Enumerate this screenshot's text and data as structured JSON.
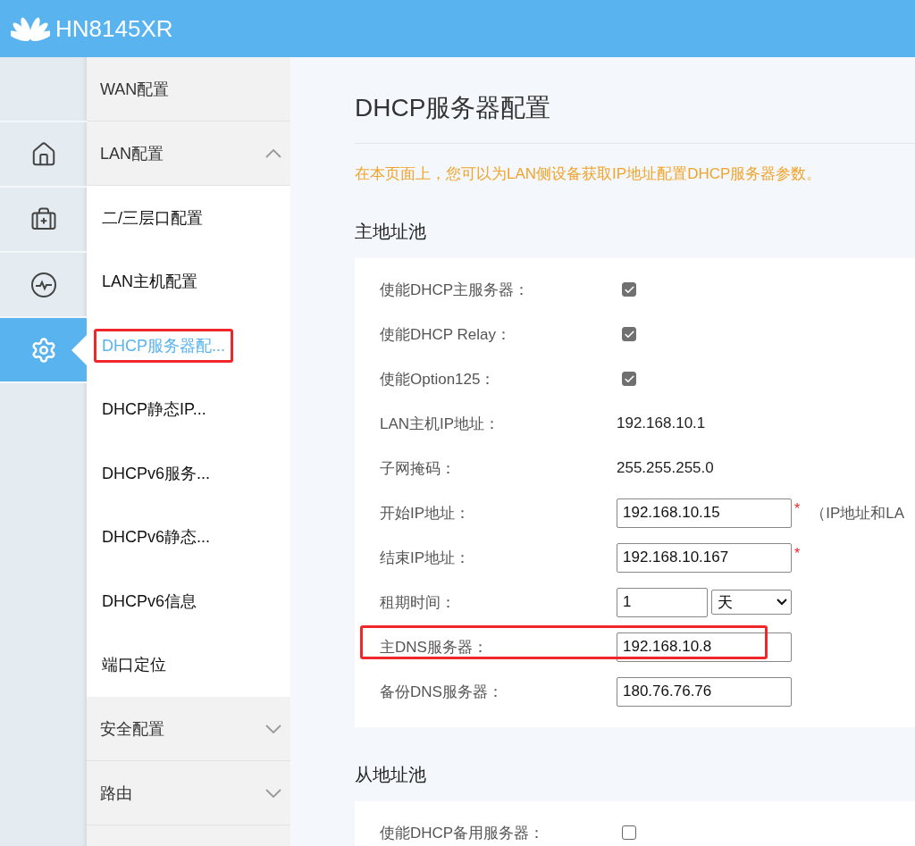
{
  "header": {
    "title": "HN8145XR"
  },
  "rail": [
    {
      "kind": "blank",
      "selected": false
    },
    {
      "kind": "home",
      "selected": false
    },
    {
      "kind": "kit",
      "selected": false
    },
    {
      "kind": "monitor",
      "selected": false
    },
    {
      "kind": "settings",
      "selected": true
    }
  ],
  "menu": [
    {
      "kind": "link",
      "label": "WAN配置"
    },
    {
      "kind": "group",
      "label": "LAN配置",
      "expanded": true,
      "children": [
        {
          "label": "二/三层口配置",
          "selected": false,
          "highlighted": false
        },
        {
          "label": "LAN主机配置",
          "selected": false,
          "highlighted": false
        },
        {
          "label": "DHCP服务器配...",
          "selected": true,
          "highlighted": true
        },
        {
          "label": "DHCP静态IP...",
          "selected": false,
          "highlighted": false
        },
        {
          "label": "DHCPv6服务...",
          "selected": false,
          "highlighted": false
        },
        {
          "label": "DHCPv6静态...",
          "selected": false,
          "highlighted": false
        },
        {
          "label": "DHCPv6信息",
          "selected": false,
          "highlighted": false
        },
        {
          "label": "端口定位",
          "selected": false,
          "highlighted": false
        }
      ]
    },
    {
      "kind": "group",
      "label": "安全配置",
      "expanded": false
    },
    {
      "kind": "group",
      "label": "路由",
      "expanded": false
    }
  ],
  "main": {
    "title": "DHCP服务器配置",
    "description": "在本页面上，您可以为LAN侧设备获取IP地址配置DHCP服务器参数。",
    "sections": [
      {
        "heading": "主地址池",
        "rows": [
          {
            "kind": "checkbox",
            "label": "使能DHCP主服务器：",
            "checked": true
          },
          {
            "kind": "checkbox",
            "label": "使能DHCP Relay：",
            "checked": true
          },
          {
            "kind": "checkbox",
            "label": "使能Option125：",
            "checked": true
          },
          {
            "kind": "text",
            "label": "LAN主机IP地址：",
            "value": "192.168.10.1"
          },
          {
            "kind": "text",
            "label": "子网掩码：",
            "value": "255.255.255.0"
          },
          {
            "kind": "input",
            "label": "开始IP地址：",
            "value": "192.168.10.15",
            "required_mark": "*",
            "note": "（IP地址和LA"
          },
          {
            "kind": "input",
            "label": "结束IP地址：",
            "value": "192.168.10.167",
            "required_mark": "*"
          },
          {
            "kind": "lease",
            "label": "租期时间：",
            "value": "1",
            "unit": "天"
          },
          {
            "kind": "input",
            "label": "主DNS服务器：",
            "value": "192.168.10.8",
            "highlighted": true
          },
          {
            "kind": "input",
            "label": "备份DNS服务器：",
            "value": "180.76.76.76"
          }
        ]
      },
      {
        "heading": "从地址池",
        "rows": [
          {
            "kind": "checkbox",
            "label": "使能DHCP备用服务器：",
            "checked": false
          }
        ]
      }
    ]
  }
}
